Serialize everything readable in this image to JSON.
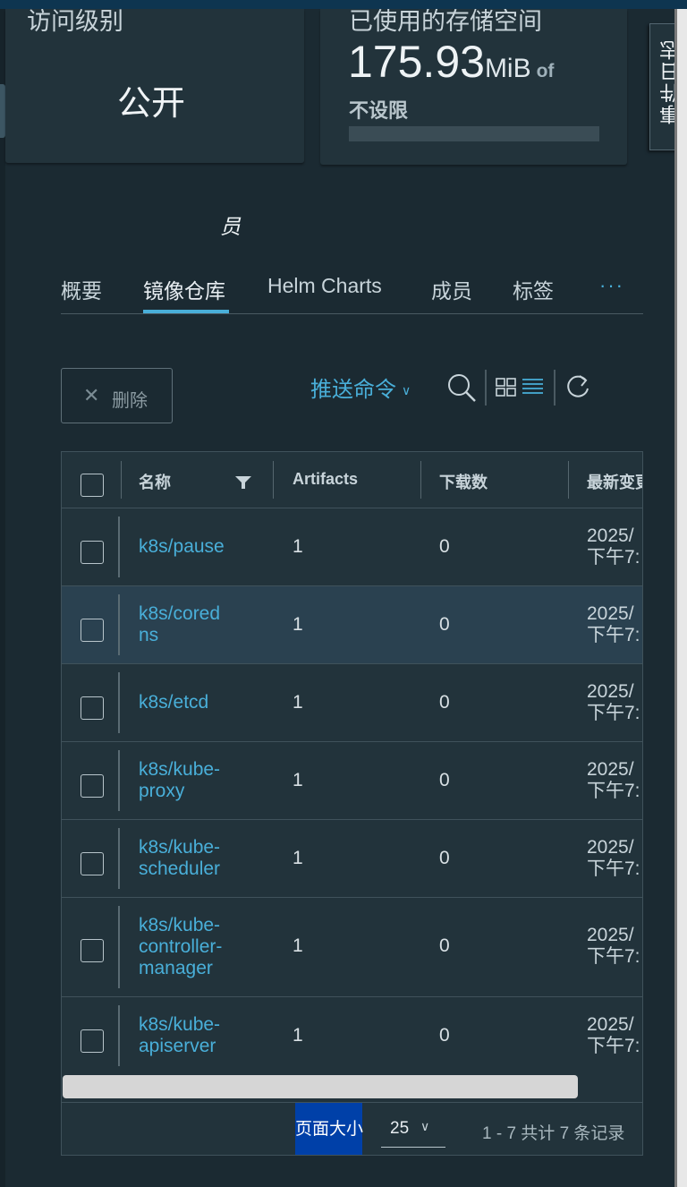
{
  "summary": {
    "access_title": "访问级别",
    "access_value": "公开",
    "storage_title": "已使用的存储空间",
    "storage_value": "175.93",
    "storage_unit": "MiB",
    "storage_of": "of",
    "storage_limit": "不设限",
    "storage_used_fraction": 0
  },
  "event_log_label": "事件日志",
  "member_fragment": "员",
  "tabs": [
    {
      "label": "概要"
    },
    {
      "label": "镜像仓库",
      "active": true
    },
    {
      "label": "Helm Charts"
    },
    {
      "label": "成员"
    },
    {
      "label": "标签"
    },
    {
      "label": "···"
    }
  ],
  "toolbar": {
    "delete_label": "删除",
    "push_label": "推送命令"
  },
  "table": {
    "columns": [
      "名称",
      "Artifacts",
      "下载数",
      "最新变更"
    ],
    "rows": [
      {
        "name": "k8s/pause",
        "artifacts": "1",
        "downloads": "0",
        "date": "2025/",
        "time": "下午7:"
      },
      {
        "name": "k8s/coredns",
        "artifacts": "1",
        "downloads": "0",
        "date": "2025/",
        "time": "下午7:",
        "selected": true
      },
      {
        "name": "k8s/etcd",
        "artifacts": "1",
        "downloads": "0",
        "date": "2025/",
        "time": "下午7:"
      },
      {
        "name": "k8s/kube-proxy",
        "artifacts": "1",
        "downloads": "0",
        "date": "2025/",
        "time": "下午7:"
      },
      {
        "name": "k8s/kube-scheduler",
        "artifacts": "1",
        "downloads": "0",
        "date": "2025/",
        "time": "下午7:"
      },
      {
        "name": "k8s/kube-controller-manager",
        "artifacts": "1",
        "downloads": "0",
        "date": "2025/",
        "time": "下午7:"
      },
      {
        "name": "k8s/kube-apiserver",
        "artifacts": "1",
        "downloads": "0",
        "date": "2025/",
        "time": "下午7:"
      }
    ]
  },
  "footer": {
    "page_size_label": "页面大小",
    "page_size_value": "25",
    "page_info": "1 - 7 共计 7 条记录"
  },
  "colors": {
    "accent": "#49afd9",
    "background": "#1b2a32",
    "card": "#22333b",
    "selected_row": "#2a4150"
  }
}
